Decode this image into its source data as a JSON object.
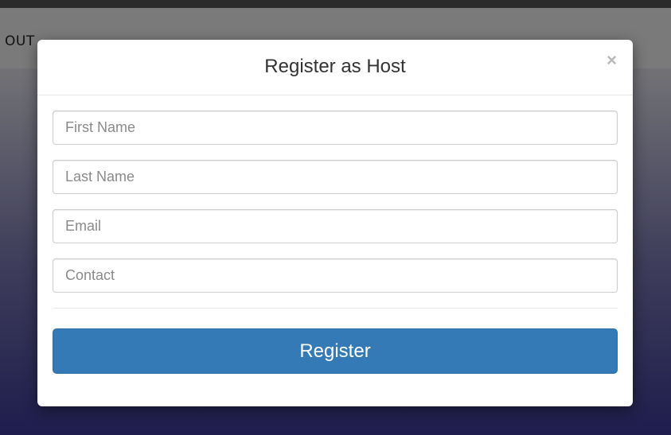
{
  "navbar": {
    "link_text": "OUT"
  },
  "modal": {
    "title": "Register as Host",
    "close_glyph": "×",
    "fields": [
      {
        "placeholder": "First Name",
        "value": ""
      },
      {
        "placeholder": "Last Name",
        "value": ""
      },
      {
        "placeholder": "Email",
        "value": ""
      },
      {
        "placeholder": "Contact",
        "value": ""
      }
    ],
    "submit_label": "Register"
  },
  "colors": {
    "primary_button": "#337ab7",
    "backdrop_gradient_bottom": "#3d3a9a"
  }
}
